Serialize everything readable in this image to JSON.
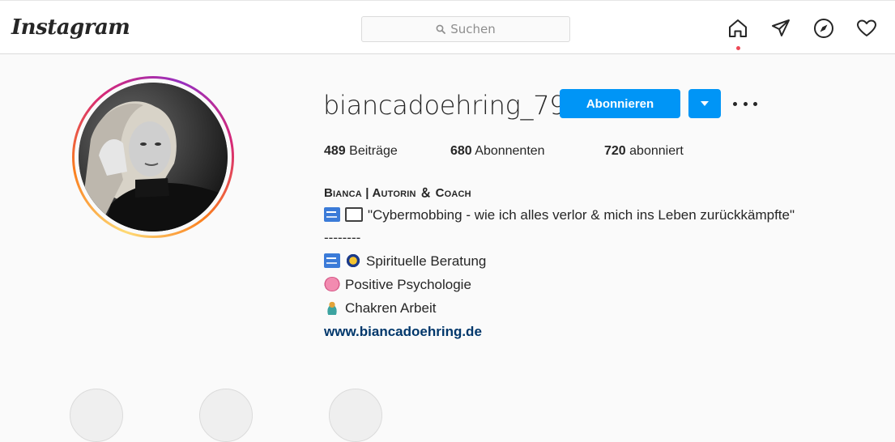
{
  "nav": {
    "logo": "Instagram",
    "search_placeholder": "Suchen",
    "icons": [
      "home-icon",
      "direct-icon",
      "explore-icon",
      "activity-icon"
    ]
  },
  "profile": {
    "username": "biancadoehring_79",
    "follow_label": "Abonnieren",
    "stats": {
      "posts_count": "489",
      "posts_label": "Beiträge",
      "followers_count": "680",
      "followers_label": "Abonnenten",
      "following_count": "720",
      "following_label": "abonniert"
    },
    "bio": {
      "name": "Bianca | Autorin ＆ Coach",
      "line1": "\"Cybermobbing - wie ich alles verlor & mich ins Leben zurückkämpfte\"",
      "separator": "--------",
      "line2": "Spirituelle Beratung",
      "line3": "Positive Psychologie",
      "line4": "Chakren Arbeit",
      "website": "www.biancadoehring.de"
    }
  },
  "colors": {
    "accent": "#0095f6",
    "link": "#00376b",
    "notification_dot": "#ed4956"
  }
}
